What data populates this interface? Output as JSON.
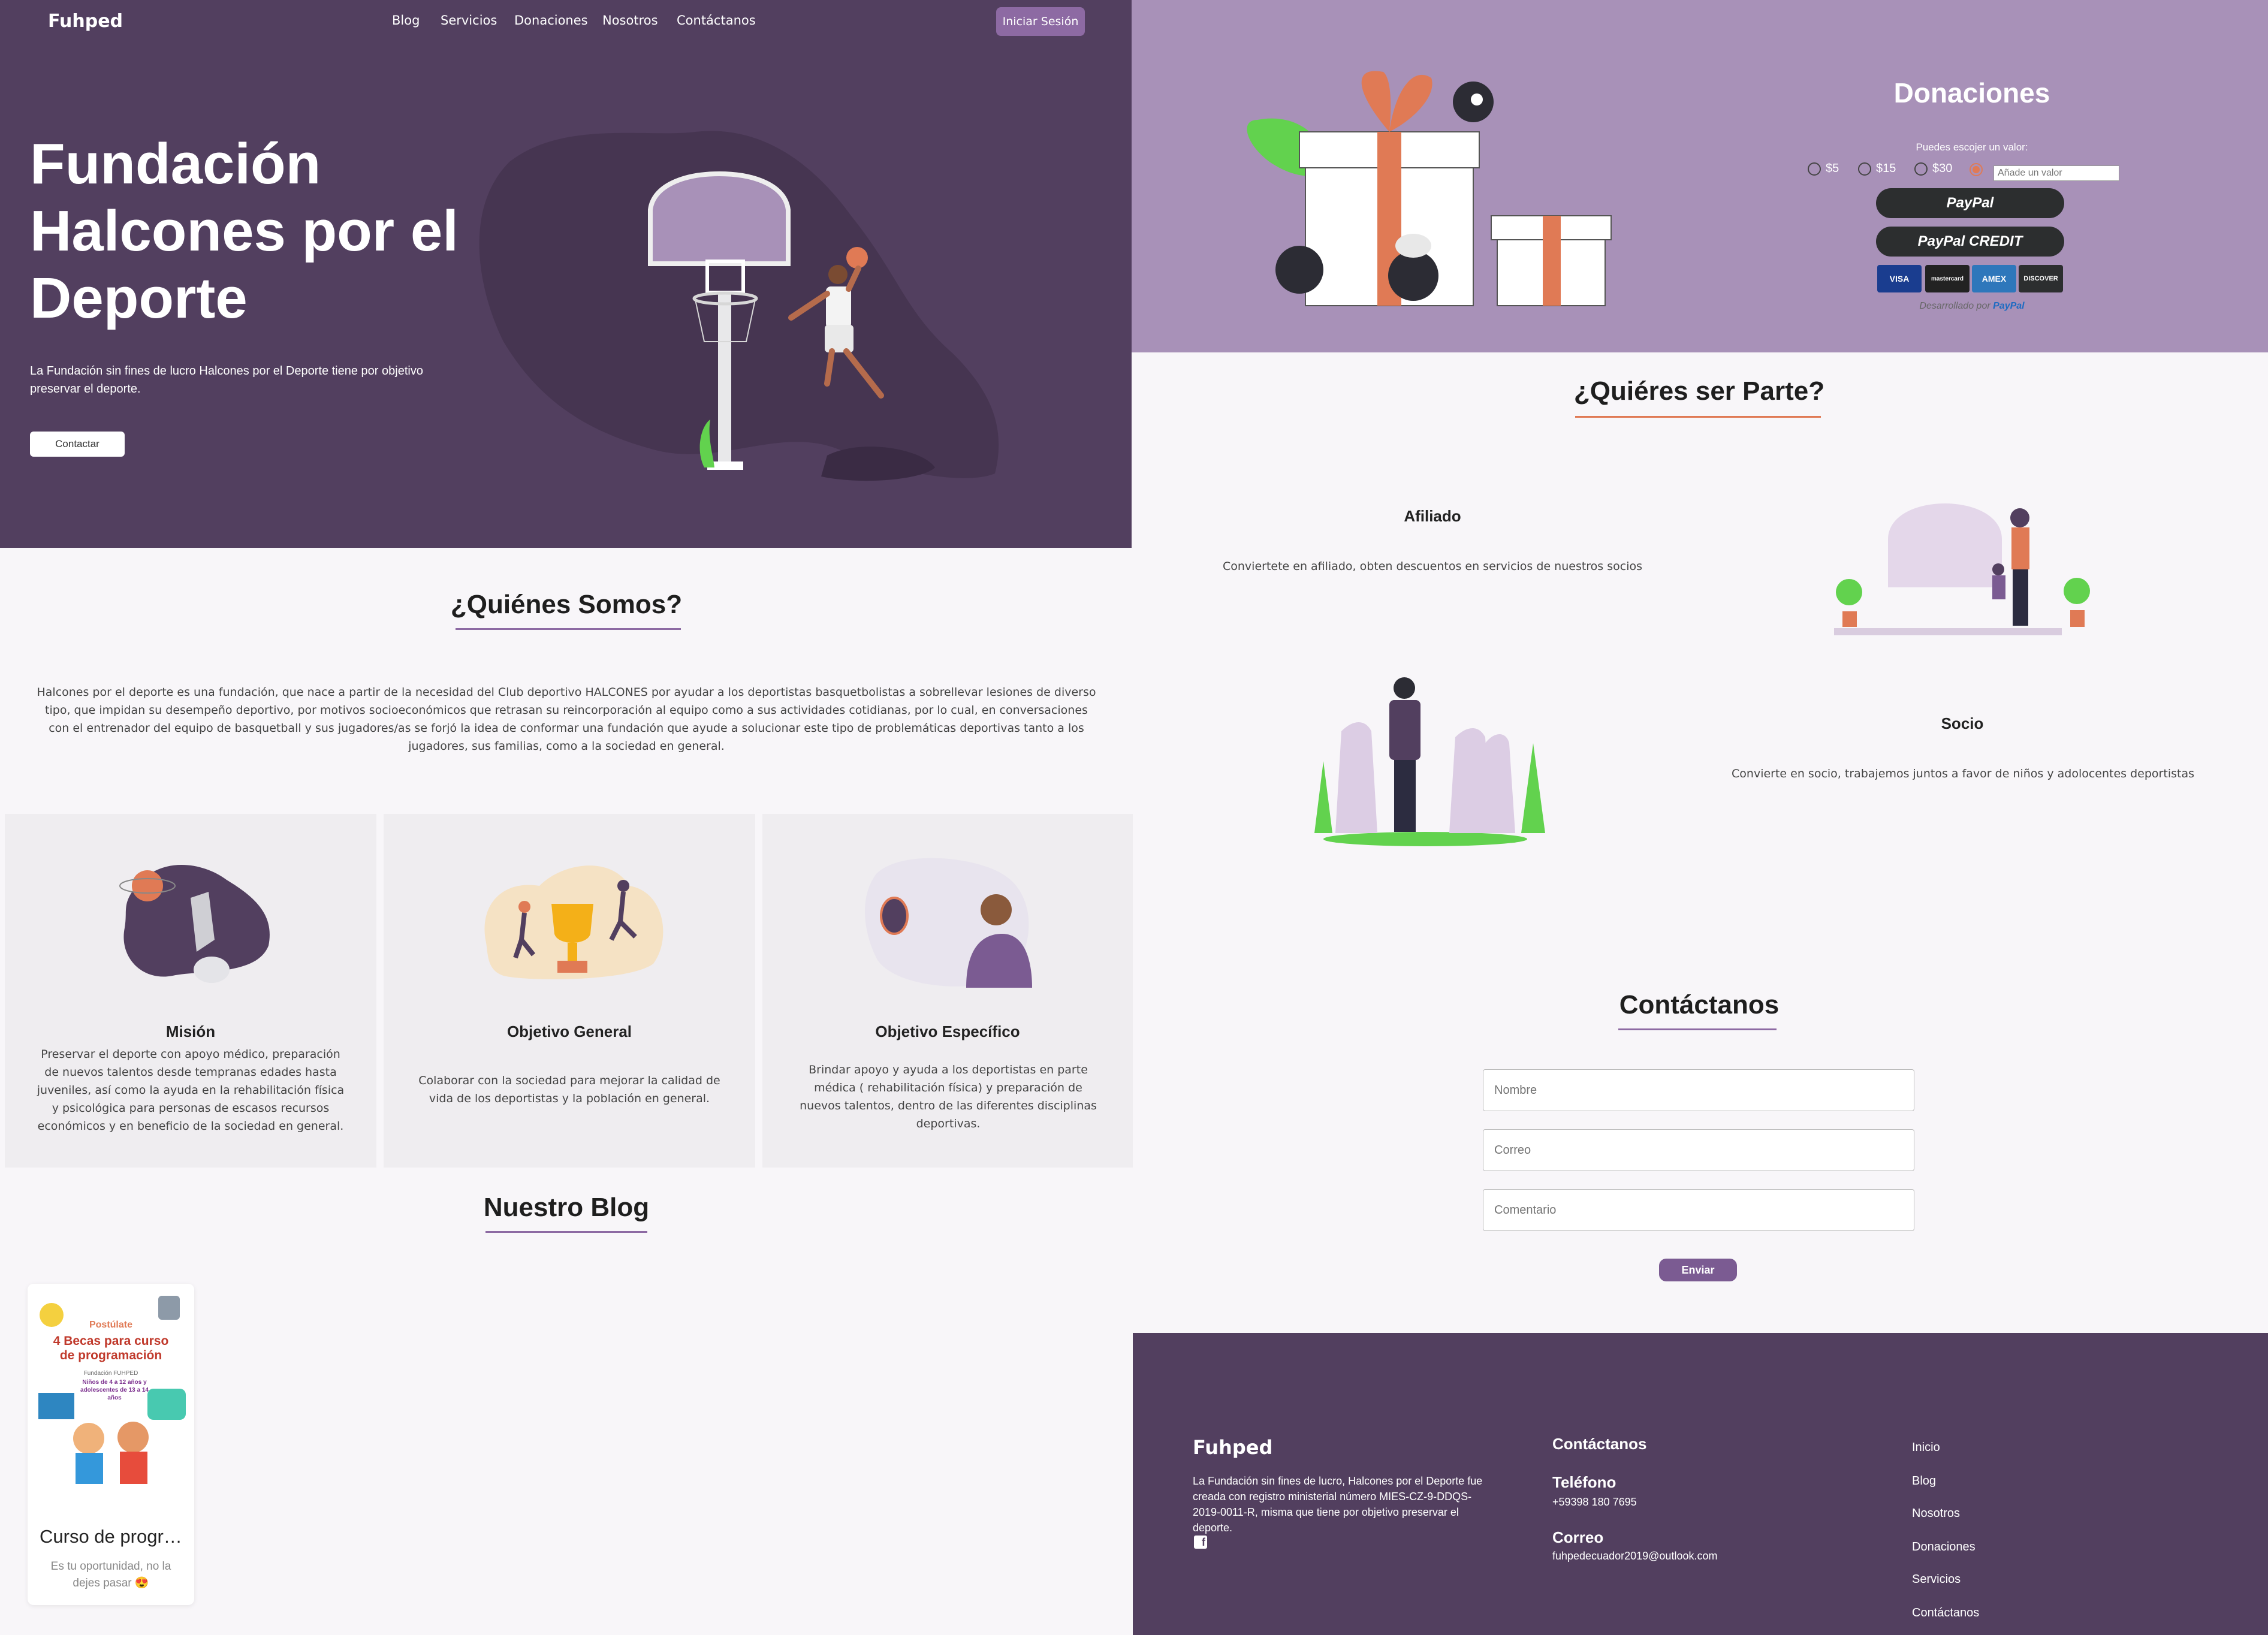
{
  "nav": {
    "brand": "Fuhped",
    "links": [
      "Blog",
      "Servicios",
      "Donaciones",
      "Nosotros",
      "Contáctanos"
    ],
    "login": "Iniciar Sesión"
  },
  "hero": {
    "title": "Fundación Halcones por el Deporte",
    "description": "La Fundación sin fines de lucro Halcones por el Deporte tiene por objetivo preservar el deporte.",
    "button": "Contactar"
  },
  "about": {
    "title": "¿Quiénes Somos?",
    "text": "Halcones por el deporte es una fundación, que nace a partir de la necesidad del Club deportivo HALCONES por ayudar a los deportistas basquetbolistas a sobrellevar lesiones de diverso tipo, que impidan su desempeño deportivo, por motivos socioeconómicos que retrasan su reincorporación al equipo como a sus actividades cotidianas, por lo cual, en conversaciones con el entrenador del equipo de basquetball y sus jugadores/as se forjó la idea de conformar una fundación que ayude a solucionar este tipo de problemáticas deportivas tanto a los jugadores, sus familias, como a la sociedad en general."
  },
  "cards": [
    {
      "title": "Misión",
      "text": "Preservar el deporte con apoyo médico, preparación de nuevos talentos desde tempranas edades hasta juveniles, así como la ayuda en la rehabilitación física y psicológica para personas de escasos recursos económicos y en beneficio de la sociedad en general."
    },
    {
      "title": "Objetivo General",
      "text": "Colaborar con la sociedad para mejorar la calidad de vida de los deportistas y la población en general."
    },
    {
      "title": "Objetivo Específico",
      "text": "Brindar apoyo y ayuda a los deportistas en parte médica ( rehabilitación física) y preparación de nuevos talentos, dentro de las diferentes disciplinas deportivas."
    }
  ],
  "blog": {
    "title": "Nuestro Blog",
    "post": {
      "title": "Curso de progra...",
      "text": "Es tu oportunidad, no la dejes pasar 😍",
      "poster": {
        "kicker": "Postúlate",
        "headline": "4 Becas para curso de programación",
        "org": "Fundación FUHPED",
        "audience": "Niños de 4 a 12 años y adolescentes de 13 a 14 años"
      }
    }
  },
  "donations": {
    "title": "Donaciones",
    "subtitle": "Puedes escojer un valor:",
    "amounts": [
      "$5",
      "$15",
      "$30"
    ],
    "input_placeholder": "Añade un valor",
    "paypal": "PayPal",
    "paypal_credit": "PayPal CREDIT",
    "cards": [
      "VISA",
      "mastercard",
      "AMEX",
      "DISCOVER"
    ],
    "powered_by": "Desarrollado por",
    "powered_brand": "PayPal",
    "colors": {
      "paypal_button": "#2c2e2f",
      "selected_radio": "#e07a55"
    }
  },
  "join": {
    "title": "¿Quiéres ser Parte?",
    "affiliate": {
      "title": "Afiliado",
      "text": "Conviertete en afiliado, obten descuentos en servicios de nuestros socios"
    },
    "partner": {
      "title": "Socio",
      "text": "Convierte en socio, trabajemos juntos a favor de niños y adolocentes deportistas"
    }
  },
  "contact": {
    "title": "Contáctanos",
    "fields": {
      "name": "Nombre",
      "email": "Correo",
      "comment": "Comentario"
    },
    "send": "Enviar"
  },
  "footer": {
    "brand": "Fuhped",
    "description": "La Fundación sin fines de lucro, Halcones por el Deporte fue creada con registro ministerial número MIES-CZ-9-DDQS-2019-0011-R, misma que tiene por objetivo preservar el deporte.",
    "contact_heading": "Contáctanos",
    "phone_label": "Teléfono",
    "phone": "+59398 180 7695",
    "email_label": "Correo",
    "email": "fuhpedecuador2019@outlook.com",
    "links": [
      "Inicio",
      "Blog",
      "Nosotros",
      "Donaciones",
      "Servicios",
      "Contáctanos"
    ]
  },
  "colors": {
    "hero_bg": "#523f5f",
    "donate_bg": "#a891b8",
    "accent": "#8d6aa3",
    "orange": "#e07a55"
  }
}
